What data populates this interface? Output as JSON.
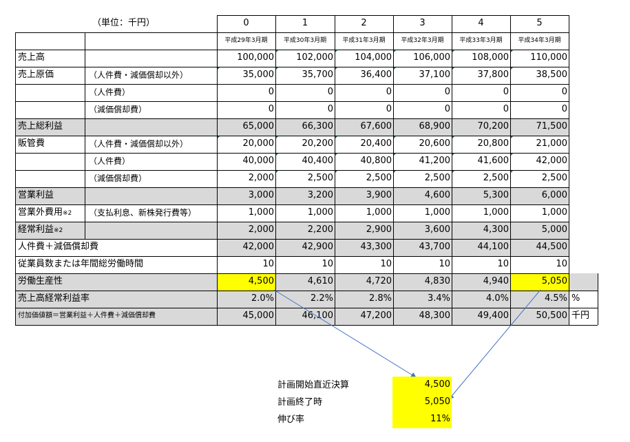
{
  "header": {
    "unit_label": "（単位：千円）",
    "years": [
      "0",
      "1",
      "2",
      "3",
      "4",
      "5"
    ],
    "periods": [
      "平成29年3月期",
      "平成30年3月期",
      "平成31年3月期",
      "平成32年3月期",
      "平成33年3月期",
      "平成34年3月期"
    ]
  },
  "rows": [
    {
      "label": "売上高",
      "sub": "",
      "values": [
        "100,000",
        "102,000",
        "104,000",
        "106,000",
        "108,000",
        "110,000"
      ]
    },
    {
      "label": "売上原価",
      "sub": "（人件費・減価償却以外）",
      "values": [
        "35,000",
        "35,700",
        "36,400",
        "37,100",
        "37,800",
        "38,500"
      ]
    },
    {
      "label": "",
      "sub": "（人件費）",
      "values": [
        "0",
        "0",
        "0",
        "0",
        "0",
        "0"
      ]
    },
    {
      "label": "",
      "sub": "（減価償却費）",
      "values": [
        "0",
        "0",
        "0",
        "0",
        "0",
        "0"
      ]
    },
    {
      "label": "売上総利益",
      "sub": "",
      "values": [
        "65,000",
        "66,300",
        "67,600",
        "68,900",
        "70,200",
        "71,500"
      ]
    },
    {
      "label": "販管費",
      "sub": "（人件費・減価償却以外）",
      "values": [
        "20,000",
        "20,200",
        "20,400",
        "20,600",
        "20,800",
        "21,000"
      ]
    },
    {
      "label": "",
      "sub": "（人件費）",
      "values": [
        "40,000",
        "40,400",
        "40,800",
        "41,200",
        "41,600",
        "42,000"
      ]
    },
    {
      "label": "",
      "sub": "（減価償却費）",
      "values": [
        "2,000",
        "2,500",
        "2,500",
        "2,500",
        "2,500",
        "2,500"
      ]
    },
    {
      "label": "営業利益",
      "sub": "",
      "values": [
        "3,000",
        "3,200",
        "3,900",
        "4,600",
        "5,300",
        "6,000"
      ]
    },
    {
      "label": "営業外費用",
      "note": "※2",
      "sub": "（支払利息、新株発行費等）",
      "values": [
        "1,000",
        "1,000",
        "1,000",
        "1,000",
        "1,000",
        "1,000"
      ]
    },
    {
      "label": "経常利益",
      "note": "※2",
      "sub": "",
      "values": [
        "2,000",
        "2,200",
        "2,900",
        "3,600",
        "4,300",
        "5,000"
      ]
    },
    {
      "label": "人件費＋減価償却費",
      "sub": "",
      "values": [
        "42,000",
        "42,900",
        "43,300",
        "43,700",
        "44,100",
        "44,500"
      ]
    },
    {
      "label": "従業員数または年間総労働時間",
      "sub": "",
      "values": [
        "10",
        "10",
        "10",
        "10",
        "10",
        "10"
      ]
    },
    {
      "label": "労働生産性",
      "sub": "",
      "values": [
        "4,500",
        "4,610",
        "4,720",
        "4,830",
        "4,940",
        "5,050"
      ],
      "unit": ""
    },
    {
      "label": "売上高経常利益率",
      "sub": "",
      "values": [
        "2.0%",
        "2.2%",
        "2.8%",
        "3.4%",
        "4.0%",
        "4.5%"
      ],
      "unit": "%"
    },
    {
      "label": "付加価値額＝営業利益＋人件費＋減価償却費",
      "sub": "",
      "values": [
        "45,000",
        "46,100",
        "47,200",
        "48,300",
        "49,400",
        "50,500"
      ],
      "unit": "千円"
    }
  ],
  "summary": [
    {
      "label": "計画開始直近決算",
      "value": "4,500"
    },
    {
      "label": "計画終了時",
      "value": "5,050"
    },
    {
      "label": "伸び率",
      "value": "11%"
    }
  ],
  "colors": {
    "highlight": "#ffff00",
    "gray": "#d9d9d9",
    "arrow": "#4472c4",
    "error_marker": "#1e7b34"
  }
}
